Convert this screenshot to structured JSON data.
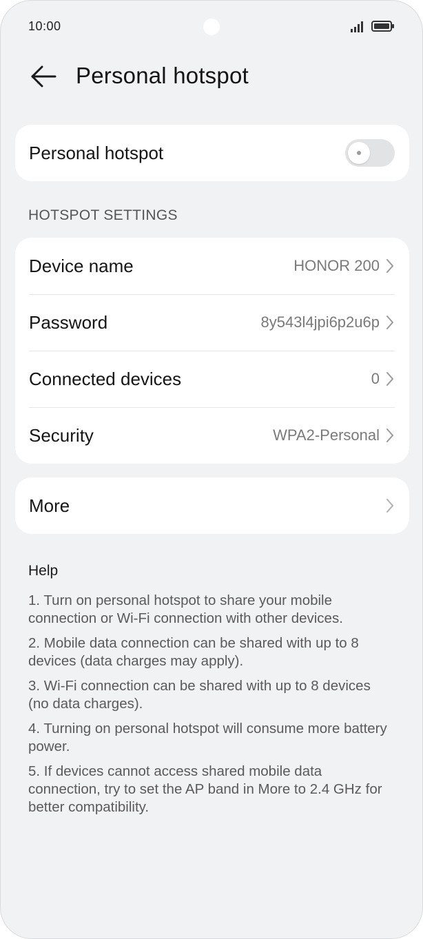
{
  "status_bar": {
    "time": "10:00"
  },
  "header": {
    "title": "Personal hotspot",
    "back_icon": "arrow-left-icon"
  },
  "hotspot_toggle": {
    "label": "Personal hotspot",
    "enabled": false
  },
  "settings": {
    "section_title": "HOTSPOT SETTINGS",
    "rows": [
      {
        "label": "Device name",
        "value": "HONOR 200"
      },
      {
        "label": "Password",
        "value": "8y543l4jpi6p2u6p"
      },
      {
        "label": "Connected devices",
        "value": "0"
      },
      {
        "label": "Security",
        "value": "WPA2-Personal"
      }
    ]
  },
  "more": {
    "label": "More"
  },
  "help": {
    "title": "Help",
    "items": [
      "1. Turn on personal hotspot to share your mobile connection or Wi-Fi connection with other devices.",
      "2. Mobile data connection can be shared with up to 8 devices (data charges may apply).",
      "3. Wi-Fi connection can be shared with up to 8 devices (no data charges).",
      "4. Turning on personal hotspot will consume more battery power.",
      "5. If devices cannot access shared mobile data connection, try to set the AP band in More to 2.4 GHz for better compatibility."
    ]
  },
  "colors": {
    "background": "#f1f2f4",
    "card": "#ffffff",
    "toggle_off": "#e2e3e5",
    "secondary_text": "#7a7a7a"
  }
}
